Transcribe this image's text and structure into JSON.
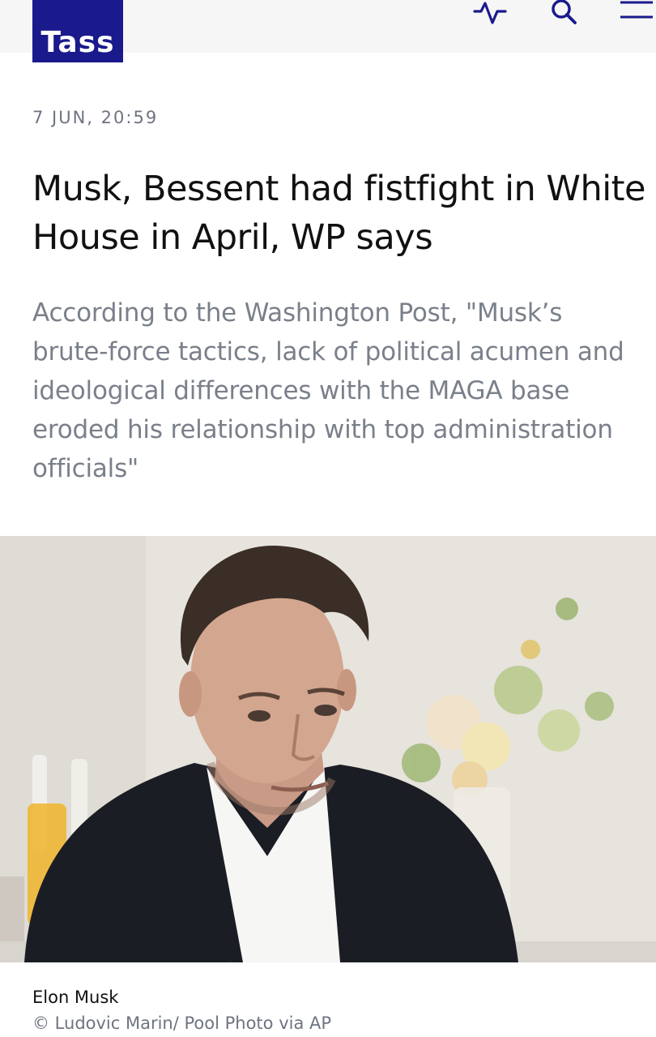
{
  "header": {
    "logo_text": "Tass",
    "brand_color": "#1a1a8c",
    "icons": [
      "activity-pulse-icon",
      "search-icon",
      "menu-icon"
    ]
  },
  "article": {
    "date": "7 JUN, 20:59",
    "headline": "Musk, Bessent had fistfight in White House in April, WP says",
    "lead": "According to the Washington Post, \"Musk’s brute-force tactics, lack of political acumen and ideological differences with the MAGA base eroded his relationship with top administration officials\""
  },
  "photo": {
    "caption": "Elon Musk",
    "credit": "© Ludovic Marin/ Pool Photo via AP"
  }
}
